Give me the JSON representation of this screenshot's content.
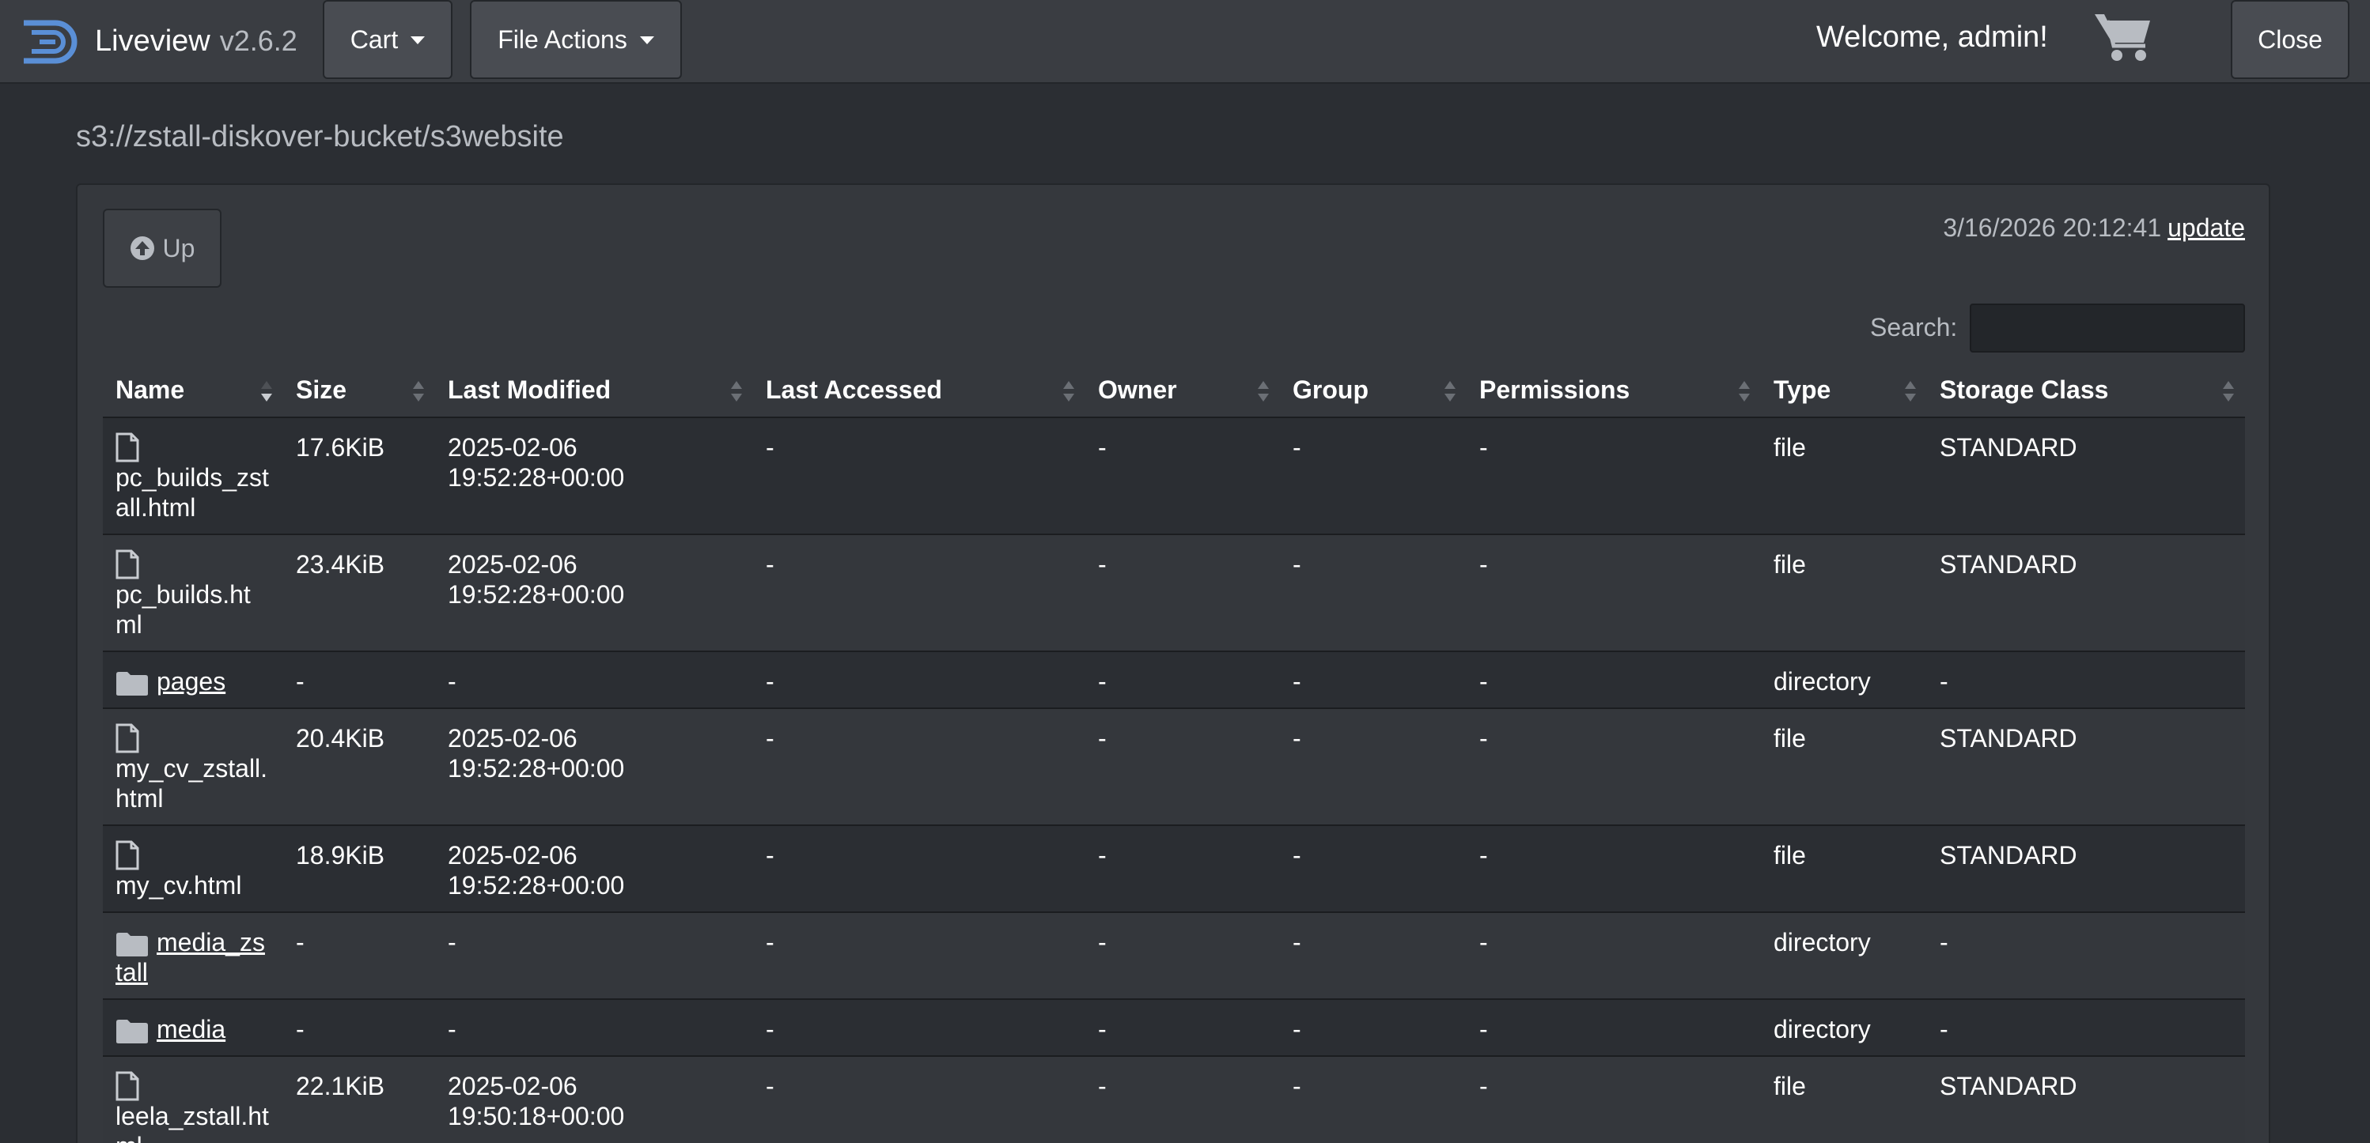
{
  "app": {
    "name": "Liveview",
    "version": "v2.6.2"
  },
  "navbar": {
    "cart_label": "Cart",
    "file_actions_label": "File Actions",
    "welcome_text": "Welcome, admin!",
    "close_label": "Close"
  },
  "path": "s3://zstall-diskover-bucket/s3website",
  "toolbar": {
    "up_label": "Up",
    "timestamp": "3/16/2026 20:12:41",
    "update_label": "update"
  },
  "search": {
    "label": "Search:",
    "value": ""
  },
  "table": {
    "headers": {
      "name": "Name",
      "size": "Size",
      "last_modified": "Last Modified",
      "last_accessed": "Last Accessed",
      "owner": "Owner",
      "group": "Group",
      "permissions": "Permissions",
      "type": "Type",
      "storage_class": "Storage Class"
    },
    "rows": [
      {
        "kind": "file",
        "name": "pc_builds_zstall.html",
        "size": "17.6KiB",
        "modified_date": "2025-02-06",
        "modified_time": "19:52:28+00:00",
        "accessed": "-",
        "owner": "-",
        "group": "-",
        "permissions": "-",
        "type": "file",
        "storage_class": "STANDARD"
      },
      {
        "kind": "file",
        "name": "pc_builds.html",
        "size": "23.4KiB",
        "modified_date": "2025-02-06",
        "modified_time": "19:52:28+00:00",
        "accessed": "-",
        "owner": "-",
        "group": "-",
        "permissions": "-",
        "type": "file",
        "storage_class": "STANDARD"
      },
      {
        "kind": "directory",
        "name": "pages",
        "size": "-",
        "modified_date": "-",
        "modified_time": "",
        "accessed": "-",
        "owner": "-",
        "group": "-",
        "permissions": "-",
        "type": "directory",
        "storage_class": "-"
      },
      {
        "kind": "file",
        "name": "my_cv_zstall.html",
        "size": "20.4KiB",
        "modified_date": "2025-02-06",
        "modified_time": "19:52:28+00:00",
        "accessed": "-",
        "owner": "-",
        "group": "-",
        "permissions": "-",
        "type": "file",
        "storage_class": "STANDARD"
      },
      {
        "kind": "file",
        "name": "my_cv.html",
        "size": "18.9KiB",
        "modified_date": "2025-02-06",
        "modified_time": "19:52:28+00:00",
        "accessed": "-",
        "owner": "-",
        "group": "-",
        "permissions": "-",
        "type": "file",
        "storage_class": "STANDARD"
      },
      {
        "kind": "directory",
        "name": "media_zstall",
        "size": "-",
        "modified_date": "-",
        "modified_time": "",
        "accessed": "-",
        "owner": "-",
        "group": "-",
        "permissions": "-",
        "type": "directory",
        "storage_class": "-"
      },
      {
        "kind": "directory",
        "name": "media",
        "size": "-",
        "modified_date": "-",
        "modified_time": "",
        "accessed": "-",
        "owner": "-",
        "group": "-",
        "permissions": "-",
        "type": "directory",
        "storage_class": "-"
      },
      {
        "kind": "file",
        "name": "leela_zstall.html",
        "size": "22.1KiB",
        "modified_date": "2025-02-06",
        "modified_time": "19:50:18+00:00",
        "accessed": "-",
        "owner": "-",
        "group": "-",
        "permissions": "-",
        "type": "file",
        "storage_class": "STANDARD"
      }
    ]
  }
}
